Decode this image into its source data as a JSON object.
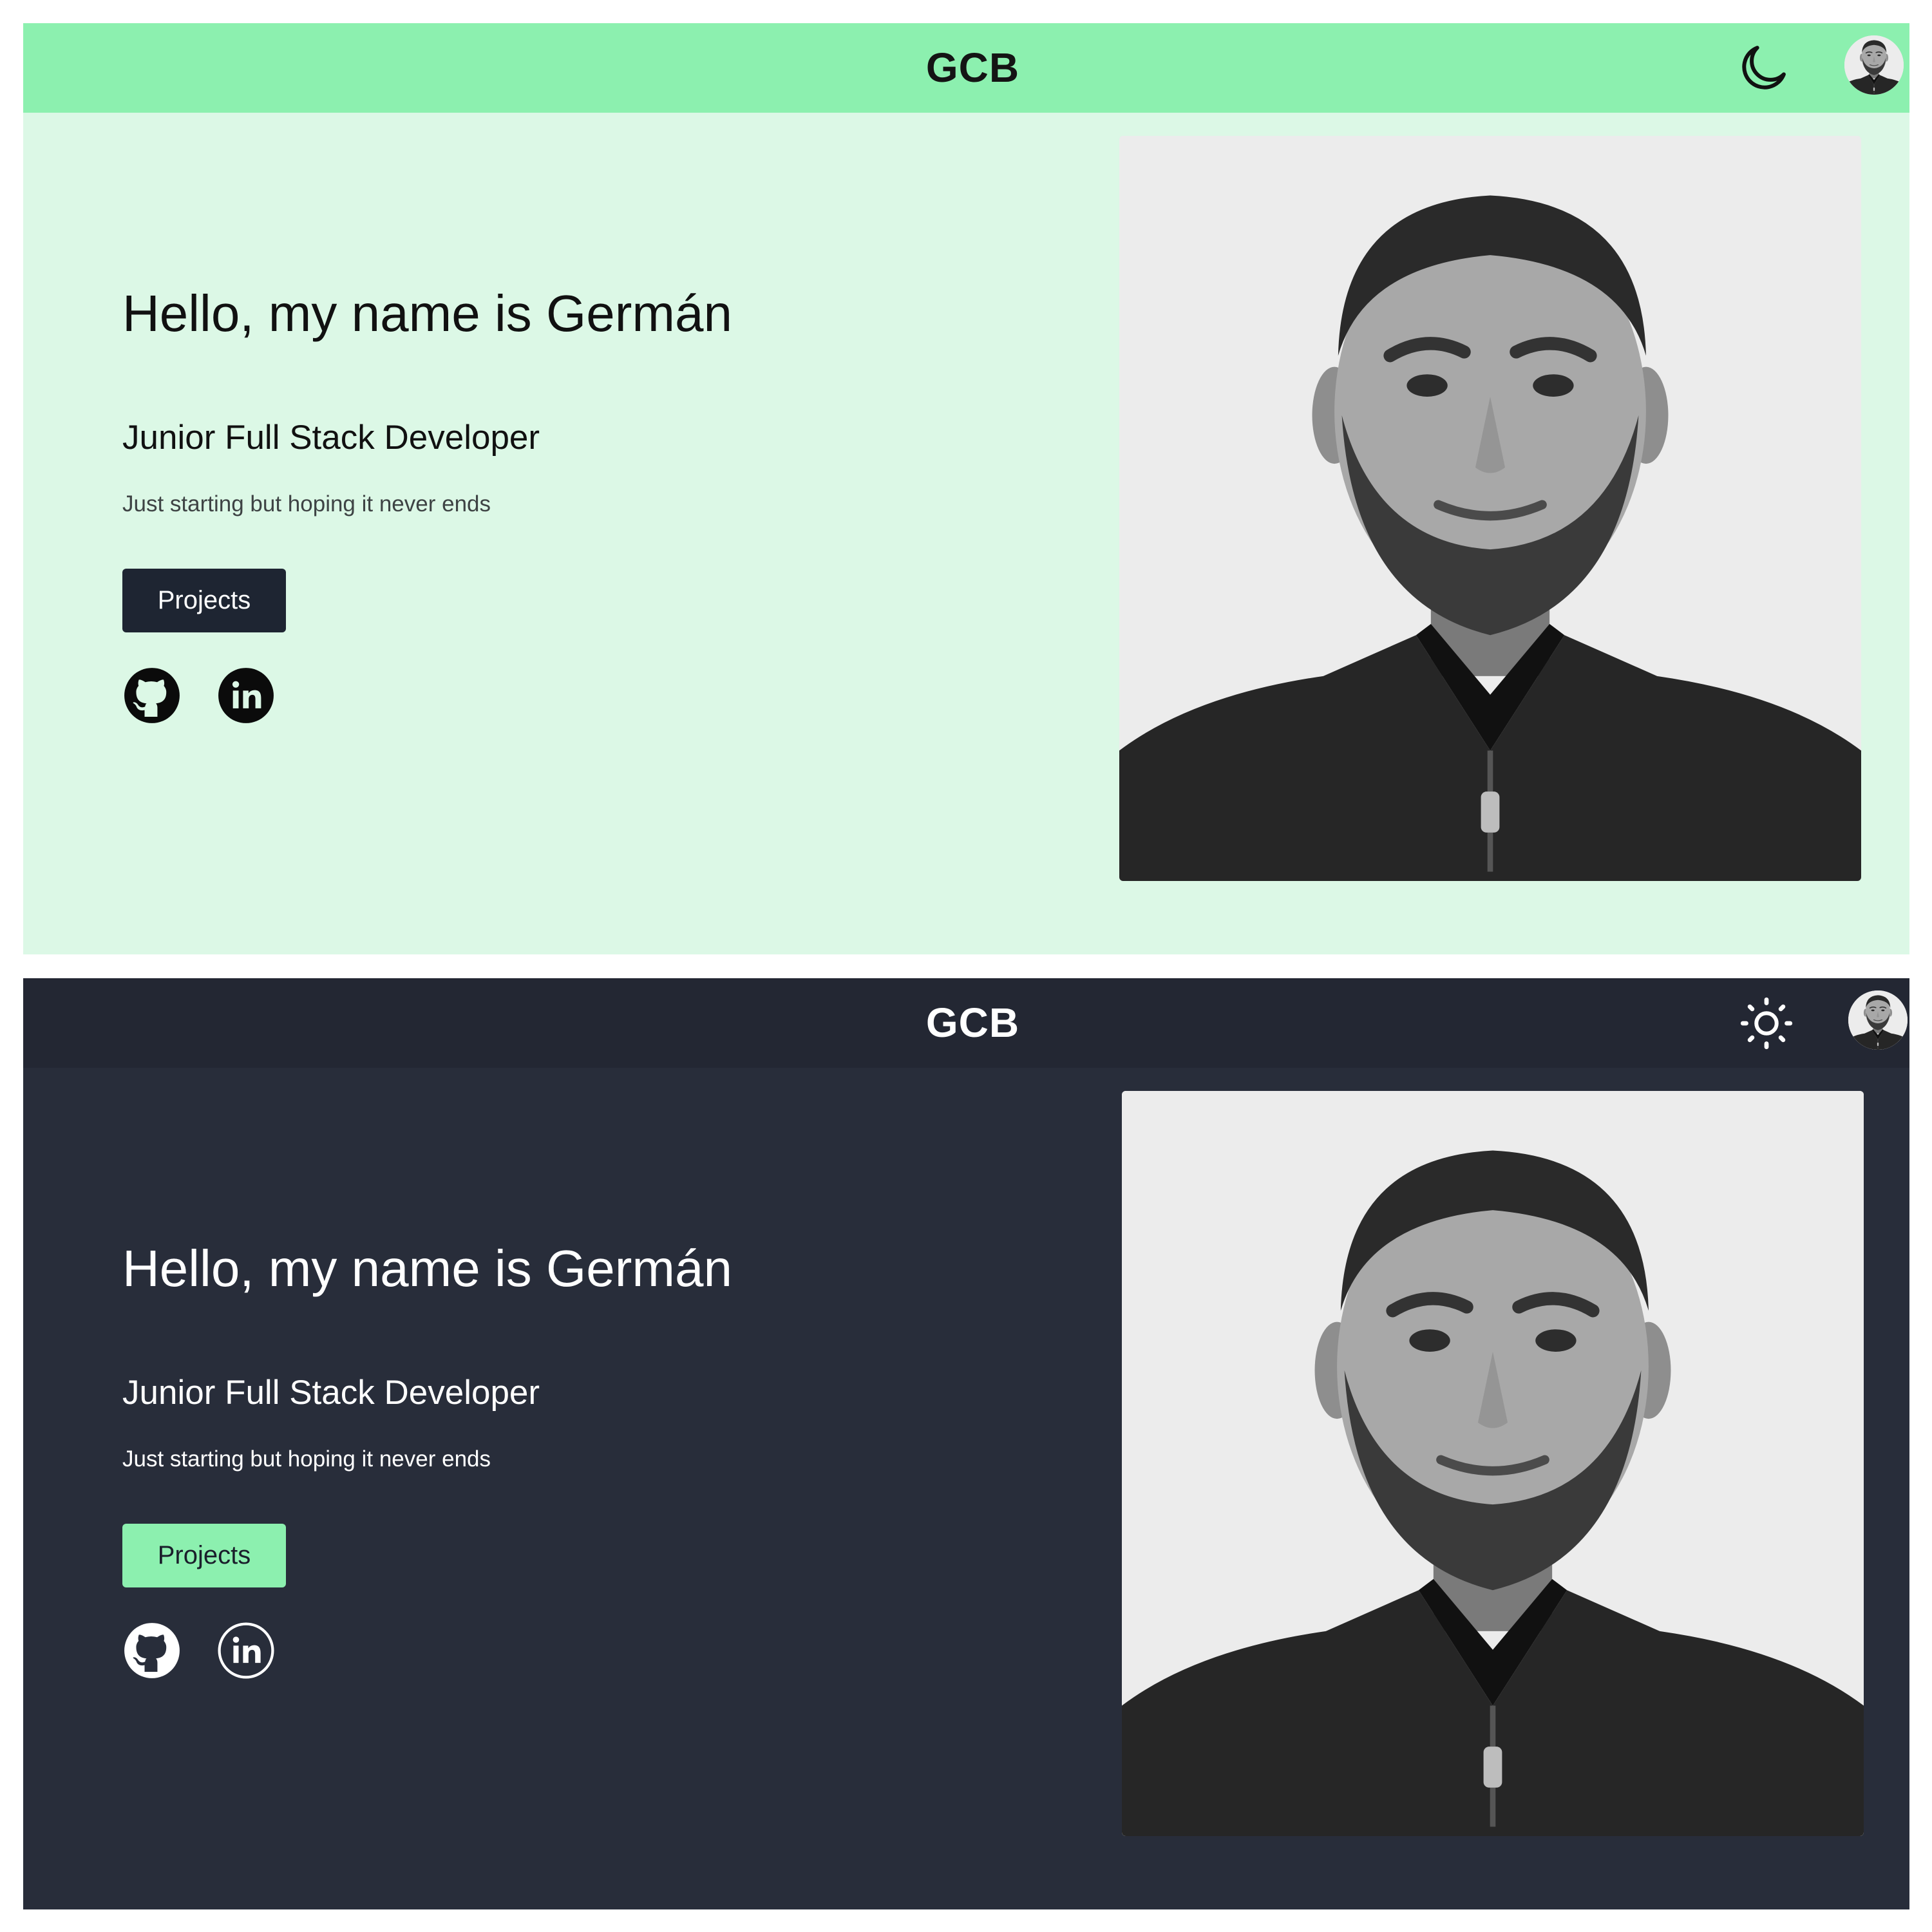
{
  "views": [
    {
      "theme": "light",
      "header": {
        "brand": "GCB",
        "theme_toggle_icon": "moon-icon",
        "avatar_icon": "avatar-photo"
      },
      "hero": {
        "greeting": "Hello, my name is Germán",
        "role": "Junior Full Stack Developer",
        "tagline": "Just starting but hoping it never ends",
        "cta_label": "Projects",
        "social_icons": [
          "github-icon",
          "linkedin-icon"
        ],
        "portrait": "portrait-photo"
      },
      "colors": {
        "page_bg": "#dcf8e6",
        "header_bg": "#8cf0af",
        "button_bg": "#1e2532",
        "button_text": "#ffffff",
        "text": "#111111"
      }
    },
    {
      "theme": "dark",
      "header": {
        "brand": "GCB",
        "theme_toggle_icon": "sun-icon",
        "avatar_icon": "avatar-photo"
      },
      "hero": {
        "greeting": "Hello, my name is Germán",
        "role": "Junior Full Stack Developer",
        "tagline": "Just starting but hoping it never ends",
        "cta_label": "Projects",
        "social_icons": [
          "github-icon",
          "linkedin-icon"
        ],
        "portrait": "portrait-photo"
      },
      "colors": {
        "page_bg": "#282d3a",
        "header_bg": "#232733",
        "button_bg": "#8cf0af",
        "button_text": "#1a1f2b",
        "text": "#ffffff"
      }
    }
  ]
}
